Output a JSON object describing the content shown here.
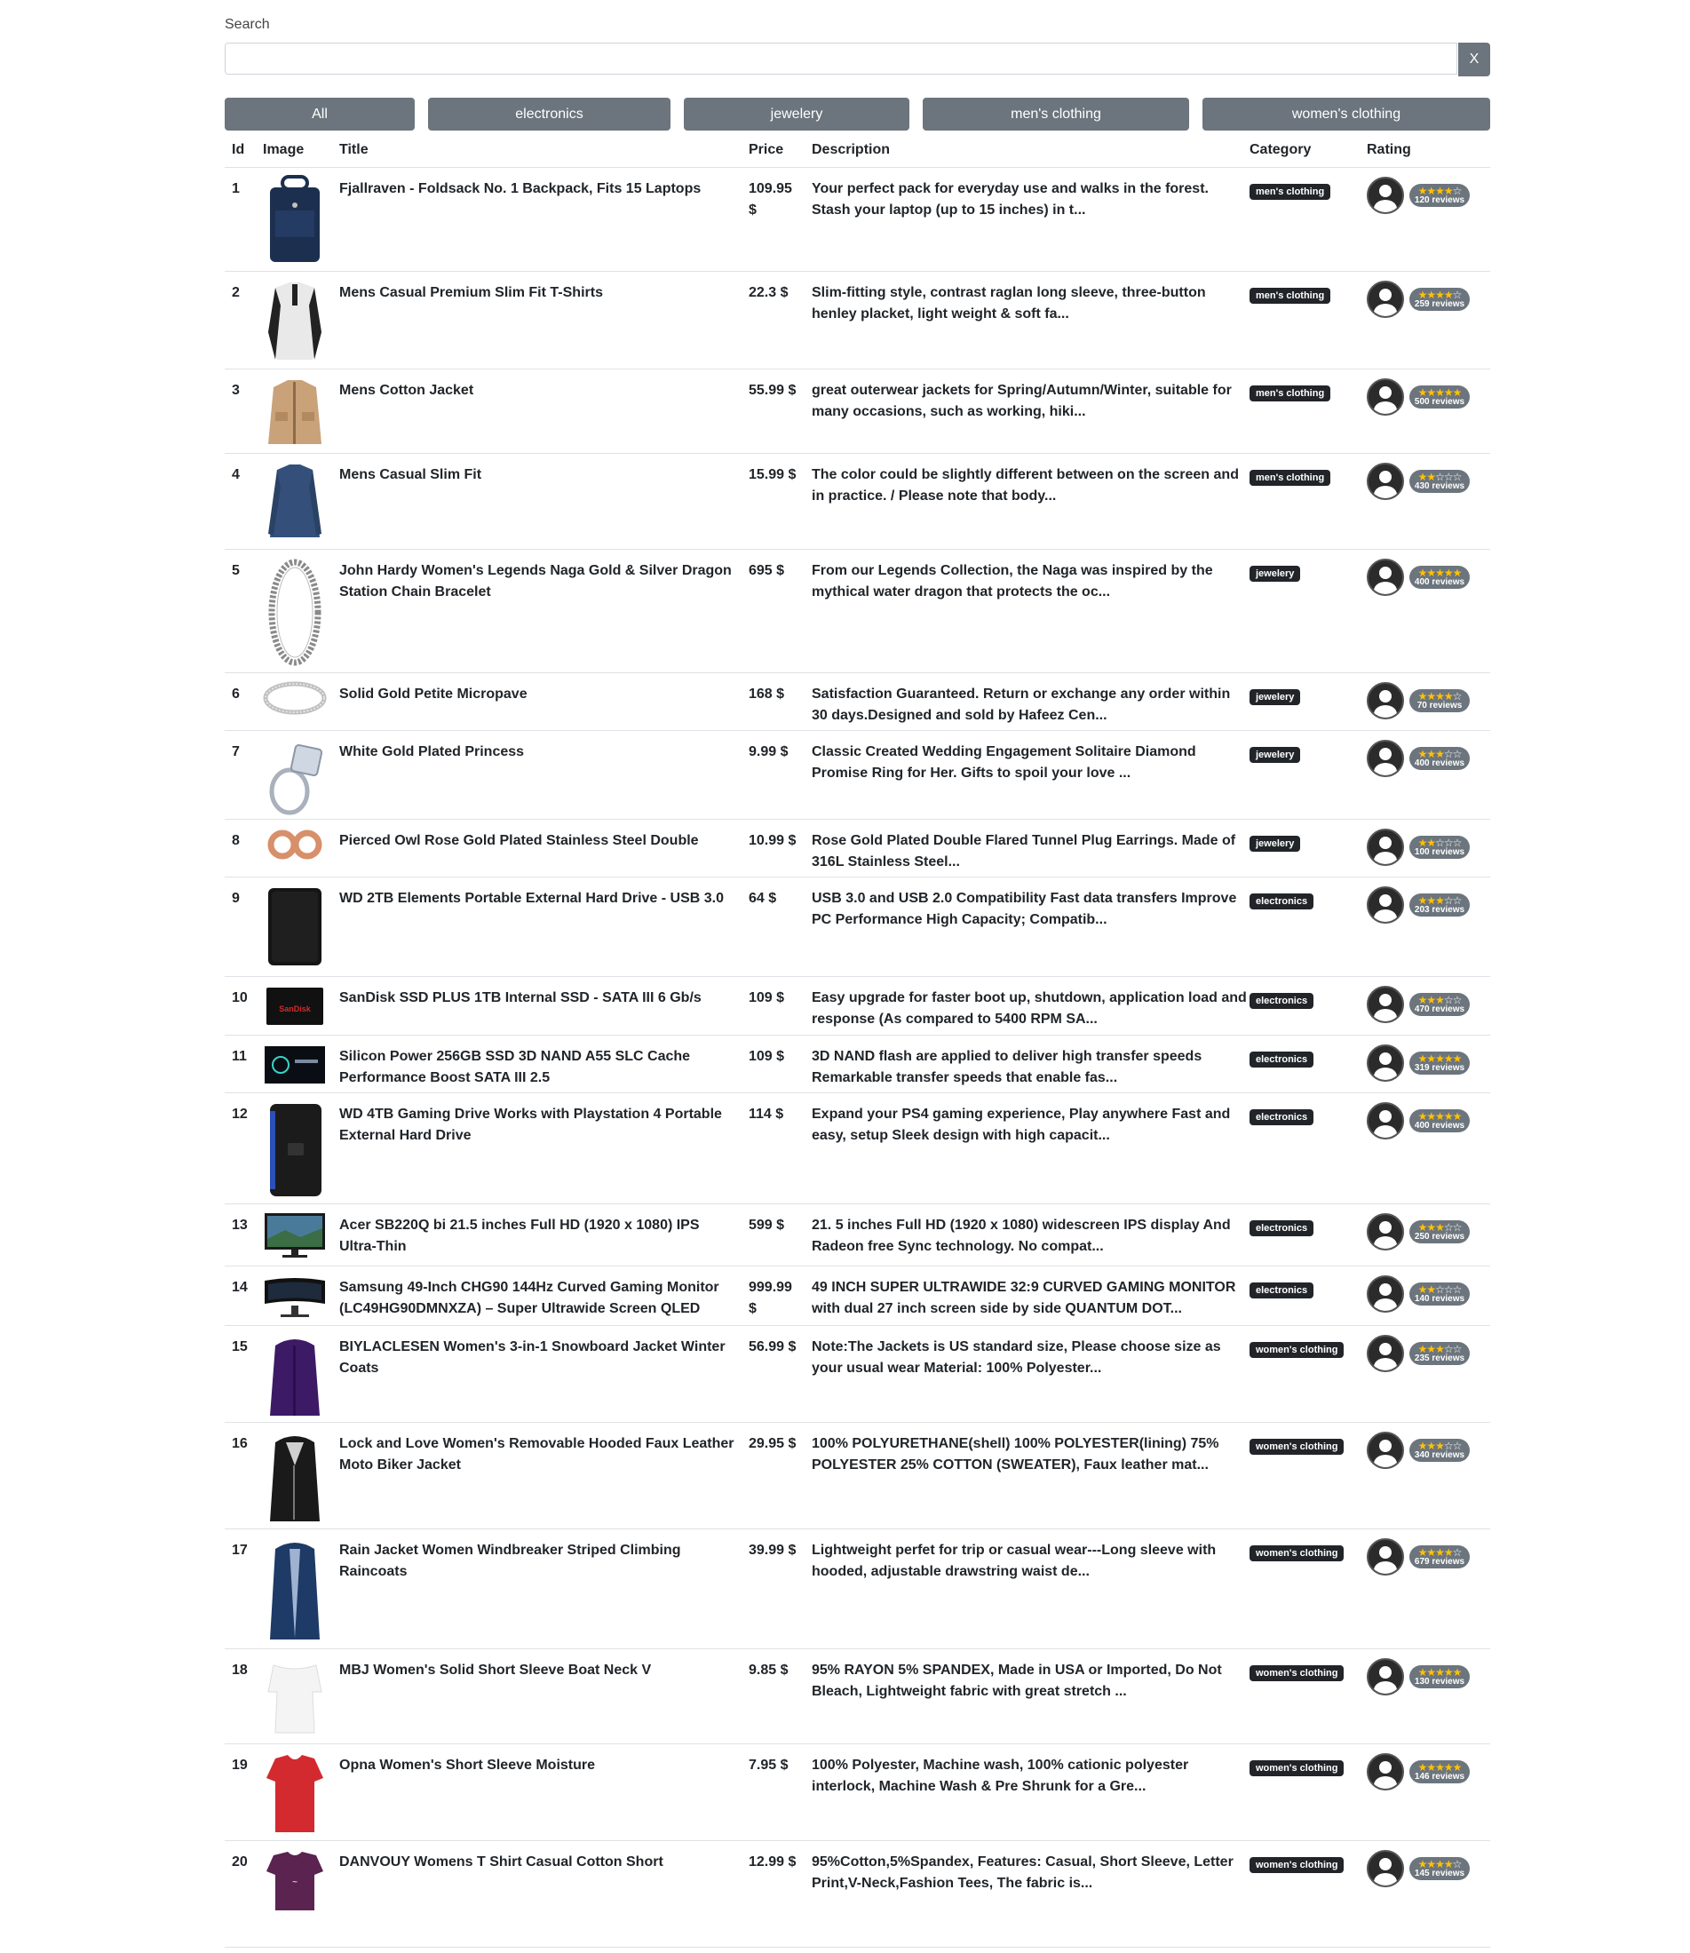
{
  "search": {
    "label": "Search",
    "value": "",
    "placeholder": "",
    "clear_label": "X"
  },
  "filters": [
    "All",
    "electronics",
    "jewelery",
    "men's clothing",
    "women's clothing"
  ],
  "columns": [
    "Id",
    "Image",
    "Title",
    "Price",
    "Description",
    "Category",
    "Rating"
  ],
  "colors": {
    "button_gray": "#6c757d",
    "badge_dark": "#212529",
    "star": "#ffc107"
  },
  "products": [
    {
      "id": "1",
      "title": "Fjallraven - Foldsack No. 1 Backpack, Fits 15 Laptops",
      "price": "109.95 $",
      "description": "Your perfect pack for everyday use and walks in the forest. Stash your laptop (up to 15 inches) in t...",
      "category": "men's clothing",
      "rating": 3.9,
      "reviews": "120 reviews",
      "image": "backpack"
    },
    {
      "id": "2",
      "title": "Mens Casual Premium Slim Fit T-Shirts",
      "price": "22.3 $",
      "description": "Slim-fitting style, contrast raglan long sleeve, three-button henley placket, light weight & soft fa...",
      "category": "men's clothing",
      "rating": 4.1,
      "reviews": "259 reviews",
      "image": "henley-shirt"
    },
    {
      "id": "3",
      "title": "Mens Cotton Jacket",
      "price": "55.99 $",
      "description": "great outerwear jackets for Spring/Autumn/Winter, suitable for many occasions, such as working, hiki...",
      "category": "men's clothing",
      "rating": 4.7,
      "reviews": "500 reviews",
      "image": "cotton-jacket"
    },
    {
      "id": "4",
      "title": "Mens Casual Slim Fit",
      "price": "15.99 $",
      "description": "The color could be slightly different between on the screen and in practice. / Please note that body...",
      "category": "men's clothing",
      "rating": 2.1,
      "reviews": "430 reviews",
      "image": "slim-shirt"
    },
    {
      "id": "5",
      "title": "John Hardy Women's Legends Naga Gold & Silver Dragon Station Chain Bracelet",
      "price": "695 $",
      "description": "From our Legends Collection, the Naga was inspired by the mythical water dragon that protects the oc...",
      "category": "jewelery",
      "rating": 4.6,
      "reviews": "400 reviews",
      "image": "bracelet"
    },
    {
      "id": "6",
      "title": "Solid Gold Petite Micropave",
      "price": "168 $",
      "description": "Satisfaction Guaranteed. Return or exchange any order within 30 days.Designed and sold by Hafeez Cen...",
      "category": "jewelery",
      "rating": 3.9,
      "reviews": "70 reviews",
      "image": "ring-band"
    },
    {
      "id": "7",
      "title": "White Gold Plated Princess",
      "price": "9.99 $",
      "description": "Classic Created Wedding Engagement Solitaire Diamond Promise Ring for Her. Gifts to spoil your love ...",
      "category": "jewelery",
      "rating": 3,
      "reviews": "400 reviews",
      "image": "diamond-ring"
    },
    {
      "id": "8",
      "title": "Pierced Owl Rose Gold Plated Stainless Steel Double",
      "price": "10.99 $",
      "description": "Rose Gold Plated Double Flared Tunnel Plug Earrings. Made of 316L Stainless Steel...",
      "category": "jewelery",
      "rating": 1.9,
      "reviews": "100 reviews",
      "image": "earrings"
    },
    {
      "id": "9",
      "title": "WD 2TB Elements Portable External Hard Drive - USB 3.0",
      "price": "64 $",
      "description": "USB 3.0 and USB 2.0 Compatibility Fast data transfers Improve PC Performance High Capacity; Compatib...",
      "category": "electronics",
      "rating": 3.3,
      "reviews": "203 reviews",
      "image": "hard-drive"
    },
    {
      "id": "10",
      "title": "SanDisk SSD PLUS 1TB Internal SSD - SATA III 6 Gb/s",
      "price": "109 $",
      "description": "Easy upgrade for faster boot up, shutdown, application load and response (As compared to 5400 RPM SA...",
      "category": "electronics",
      "rating": 2.9,
      "reviews": "470 reviews",
      "image": "sandisk-ssd"
    },
    {
      "id": "11",
      "title": "Silicon Power 256GB SSD 3D NAND A55 SLC Cache Performance Boost SATA III 2.5",
      "price": "109 $",
      "description": "3D NAND flash are applied to deliver high transfer speeds Remarkable transfer speeds that enable fas...",
      "category": "electronics",
      "rating": 4.8,
      "reviews": "319 reviews",
      "image": "silicon-ssd"
    },
    {
      "id": "12",
      "title": "WD 4TB Gaming Drive Works with Playstation 4 Portable External Hard Drive",
      "price": "114 $",
      "description": "Expand your PS4 gaming experience, Play anywhere Fast and easy, setup Sleek design with high capacit...",
      "category": "electronics",
      "rating": 4.8,
      "reviews": "400 reviews",
      "image": "gaming-drive"
    },
    {
      "id": "13",
      "title": "Acer SB220Q bi 21.5 inches Full HD (1920 x 1080) IPS Ultra-Thin",
      "price": "599 $",
      "description": "21. 5 inches Full HD (1920 x 1080) widescreen IPS display And Radeon free Sync technology. No compat...",
      "category": "electronics",
      "rating": 2.9,
      "reviews": "250 reviews",
      "image": "monitor"
    },
    {
      "id": "14",
      "title": "Samsung 49-Inch CHG90 144Hz Curved Gaming Monitor (LC49HG90DMNXZA) – Super Ultrawide Screen QLED",
      "price": "999.99 $",
      "description": "49 INCH SUPER ULTRAWIDE 32:9 CURVED GAMING MONITOR with dual 27 inch screen side by side QUANTUM DOT...",
      "category": "electronics",
      "rating": 2.2,
      "reviews": "140 reviews",
      "image": "curved-monitor"
    },
    {
      "id": "15",
      "title": "BIYLACLESEN Women's 3-in-1 Snowboard Jacket Winter Coats",
      "price": "56.99 $",
      "description": "Note:The Jackets is US standard size, Please choose size as your usual wear Material: 100% Polyester...",
      "category": "women's clothing",
      "rating": 2.6,
      "reviews": "235 reviews",
      "image": "snowboard-jacket"
    },
    {
      "id": "16",
      "title": "Lock and Love Women's Removable Hooded Faux Leather Moto Biker Jacket",
      "price": "29.95 $",
      "description": "100% POLYURETHANE(shell) 100% POLYESTER(lining) 75% POLYESTER 25% COTTON (SWEATER), Faux leather mat...",
      "category": "women's clothing",
      "rating": 2.9,
      "reviews": "340 reviews",
      "image": "leather-jacket"
    },
    {
      "id": "17",
      "title": "Rain Jacket Women Windbreaker Striped Climbing Raincoats",
      "price": "39.99 $",
      "description": "Lightweight perfet for trip or casual wear---Long sleeve with hooded, adjustable drawstring waist de...",
      "category": "women's clothing",
      "rating": 3.8,
      "reviews": "679 reviews",
      "image": "rain-jacket"
    },
    {
      "id": "18",
      "title": "MBJ Women's Solid Short Sleeve Boat Neck V",
      "price": "9.85 $",
      "description": "95% RAYON 5% SPANDEX, Made in USA or Imported, Do Not Bleach, Lightweight fabric with great stretch ...",
      "category": "women's clothing",
      "rating": 4.7,
      "reviews": "130 reviews",
      "image": "boat-neck-top"
    },
    {
      "id": "19",
      "title": "Opna Women's Short Sleeve Moisture",
      "price": "7.95 $",
      "description": "100% Polyester, Machine wash, 100% cationic polyester interlock, Machine Wash & Pre Shrunk for a Gre...",
      "category": "women's clothing",
      "rating": 4.5,
      "reviews": "146 reviews",
      "image": "red-shirt"
    },
    {
      "id": "20",
      "title": "DANVOUY Womens T Shirt Casual Cotton Short",
      "price": "12.99 $",
      "description": "95%Cotton,5%Spandex, Features: Casual, Short Sleeve, Letter Print,V-Neck,Fashion Tees, The fabric is...",
      "category": "women's clothing",
      "rating": 3.6,
      "reviews": "145 reviews",
      "image": "purple-tee"
    }
  ]
}
